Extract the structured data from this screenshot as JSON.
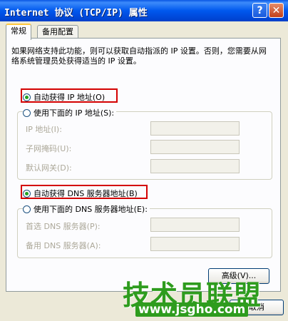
{
  "window": {
    "title": "Internet 协议 (TCP/IP) 属性",
    "help_glyph": "?",
    "close_glyph": "✕"
  },
  "tabs": [
    {
      "label": "常规",
      "active": true
    },
    {
      "label": "备用配置",
      "active": false
    }
  ],
  "description": "如果网络支持此功能，则可以获取自动指派的 IP 设置。否则，您需要从网络系统管理员处获得适当的 IP 设置。",
  "ip_section": {
    "auto_option": {
      "label": "自动获得 IP 地址(O)",
      "checked": true
    },
    "manual_option": {
      "label": "使用下面的 IP 地址(S):",
      "checked": false
    },
    "fields": [
      {
        "label": "IP 地址(I):",
        "value": ""
      },
      {
        "label": "子网掩码(U):",
        "value": ""
      },
      {
        "label": "默认网关(D):",
        "value": ""
      }
    ]
  },
  "dns_section": {
    "auto_option": {
      "label": "自动获得 DNS 服务器地址(B)",
      "checked": true
    },
    "manual_option": {
      "label": "使用下面的 DNS 服务器地址(E):",
      "checked": false
    },
    "fields": [
      {
        "label": "首选 DNS 服务器(P):",
        "value": ""
      },
      {
        "label": "备用 DNS 服务器(A):",
        "value": ""
      }
    ]
  },
  "buttons": {
    "advanced": "高级(V)...",
    "cancel": "取消"
  },
  "watermark": {
    "brand": "技术员联盟",
    "url": "www.jsgho.com"
  },
  "colors": {
    "title_bar": "#0058EE",
    "highlight_box": "#D40000",
    "radio_checked": "#21A121",
    "watermark": "#2E9C1E"
  }
}
